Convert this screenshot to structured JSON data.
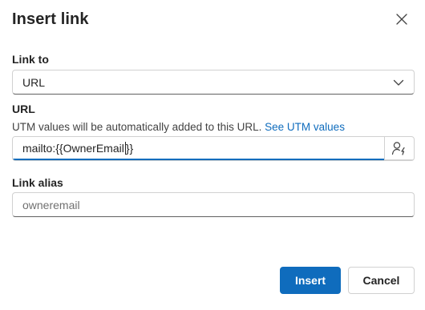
{
  "dialog": {
    "title": "Insert link",
    "close_icon": "close-icon"
  },
  "link_to": {
    "label": "Link to",
    "selected": "URL",
    "chevron_icon": "chevron-down-icon"
  },
  "url": {
    "label": "URL",
    "hint": "UTM values will be automatically added to this URL.",
    "hint_link": "See UTM values",
    "value_before_caret": "mailto:{{OwnerEmail",
    "value_after_caret": "}}",
    "personalize_icon": "personalization-icon"
  },
  "alias": {
    "label": "Link alias",
    "value": "",
    "placeholder": "owneremail"
  },
  "footer": {
    "insert_label": "Insert",
    "cancel_label": "Cancel"
  },
  "colors": {
    "accent": "#0f6cbd",
    "text": "#242424",
    "border": "#d1d1d1"
  }
}
